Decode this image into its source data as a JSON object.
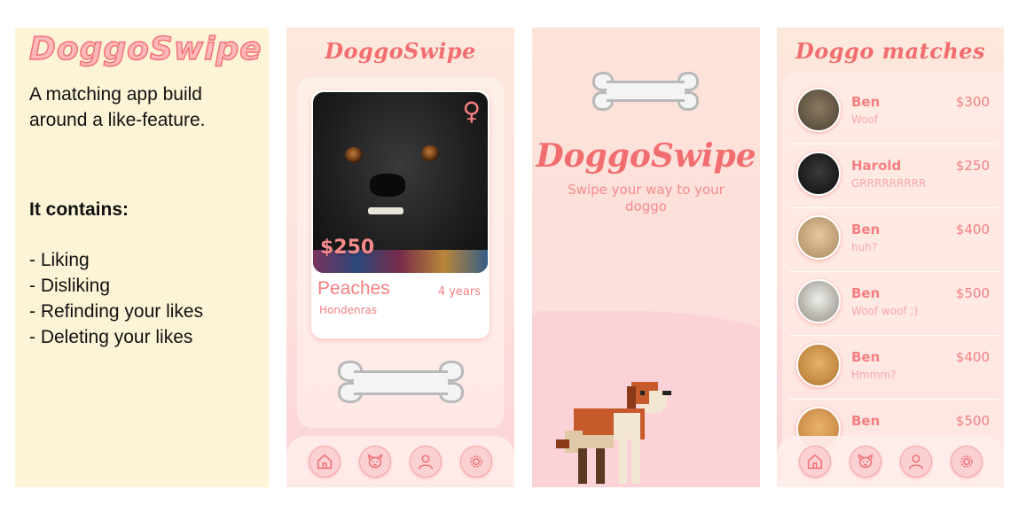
{
  "description": {
    "logo": "DoggoSwipe",
    "intro": "A matching app build around a like-feature.",
    "contains_heading": "It contains:",
    "features": [
      "- Liking",
      "- Disliking",
      "- Refinding your likes",
      "- Deleting your likes"
    ]
  },
  "swipe_screen": {
    "title": "DoggoSwipe",
    "card": {
      "price": "$250",
      "gender_icon": "female-icon",
      "name": "Peaches",
      "age": "4 years",
      "breed": "Hondenras"
    }
  },
  "splash_screen": {
    "title": "DoggoSwipe",
    "subtitle": "Swipe your way to your doggo"
  },
  "matches_screen": {
    "title": "Doggo matches",
    "items": [
      {
        "name": "Ben",
        "price": "$300",
        "message": "Woof"
      },
      {
        "name": "Harold",
        "price": "$250",
        "message": "GRRRRRRRRR"
      },
      {
        "name": "Ben",
        "price": "$400",
        "message": "huh?"
      },
      {
        "name": "Ben",
        "price": "$500",
        "message": "Woof woof ;)"
      },
      {
        "name": "Ben",
        "price": "$400",
        "message": "Hmmm?"
      },
      {
        "name": "Ben",
        "price": "$500",
        "message": ""
      }
    ]
  },
  "navbar": {
    "icons": [
      "home-icon",
      "dog-face-icon",
      "profile-icon",
      "settings-icon"
    ]
  },
  "colors": {
    "accent": "#f26d6f",
    "panel_bg": "#fdf3d6",
    "phone_bg": "#fde3dc"
  }
}
